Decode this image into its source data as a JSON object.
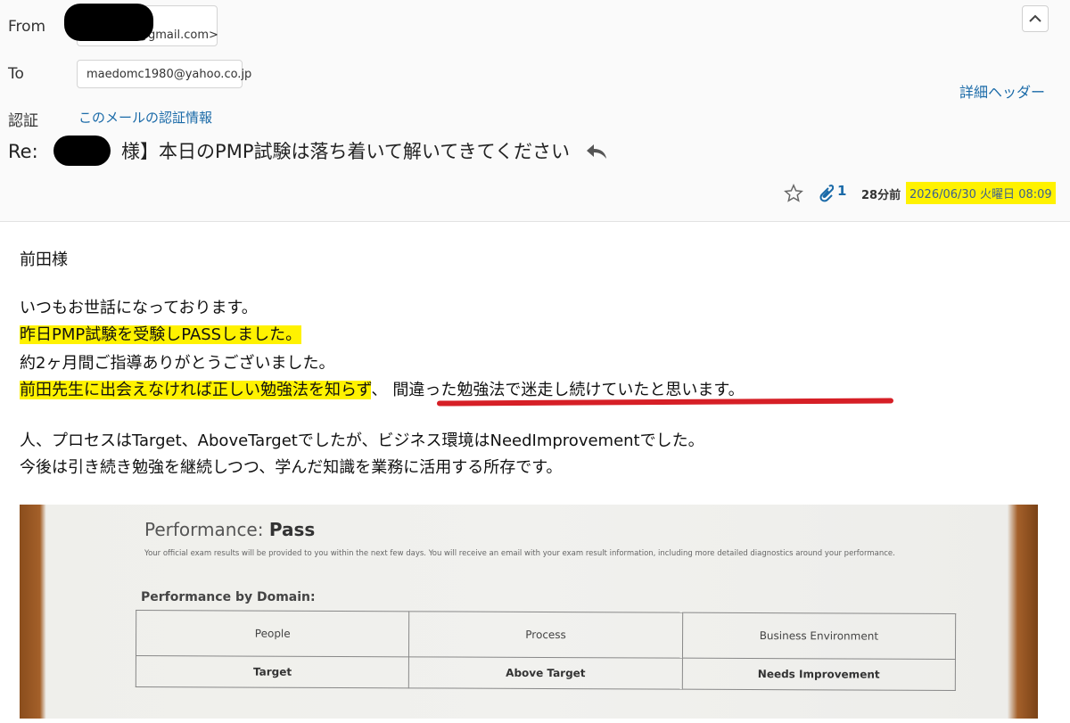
{
  "header": {
    "from_label": "From",
    "from_email_visible": "@gmail.com>",
    "to_label": "To",
    "to_email": "maedomc1980@yahoo.co.jp",
    "auth_label": "認証",
    "auth_link": "このメールの認証情報",
    "detail_header_link": "詳細ヘッダー",
    "subject_prefix": "Re:",
    "subject_text": "様】本日のPMP試験は落ち着いて解いてきてください",
    "attachment_count": "1",
    "relative_time": "28分前",
    "datetime": "2026/06/30 火曜日 08:09"
  },
  "body": {
    "greeting": "前田様",
    "line1": "いつもお世話になっております。",
    "line2": "昨日PMP試験を受験しPASSしました。",
    "line3": "約2ヶ月間ご指導ありがとうございました。",
    "line4_highlighted": "前田先生に出会えなければ正しい勉強法を知らず",
    "line4_comma": "、",
    "line4_rest": "間違った勉強法で迷走し続けていたと思います。",
    "line5": "人、プロセスはTarget、AboveTargetでしたが、ビジネス環境はNeedImprovementでした。",
    "line6": "今後は引き続き勉強を継続しつつ、学んだ知識を業務に活用する所存です。"
  },
  "result_image": {
    "performance_label": "Performance:",
    "performance_value": "Pass",
    "description": "Your official exam results will be provided to you within the next few days. You will receive an email with your exam result information, including more detailed diagnostics around your performance.",
    "domain_title": "Performance by Domain:",
    "domains": [
      {
        "name": "People",
        "result": "Target"
      },
      {
        "name": "Process",
        "result": "Above Target"
      },
      {
        "name": "Business Environment",
        "result": "Needs Improvement"
      }
    ]
  },
  "icons": {
    "reply": "reply-arrow-icon",
    "star": "star-icon",
    "attachment": "paperclip-icon",
    "collapse": "chevron-up-icon"
  },
  "colors": {
    "link": "#1a6aa8",
    "highlight": "#fff200",
    "underline": "#d61f26"
  }
}
